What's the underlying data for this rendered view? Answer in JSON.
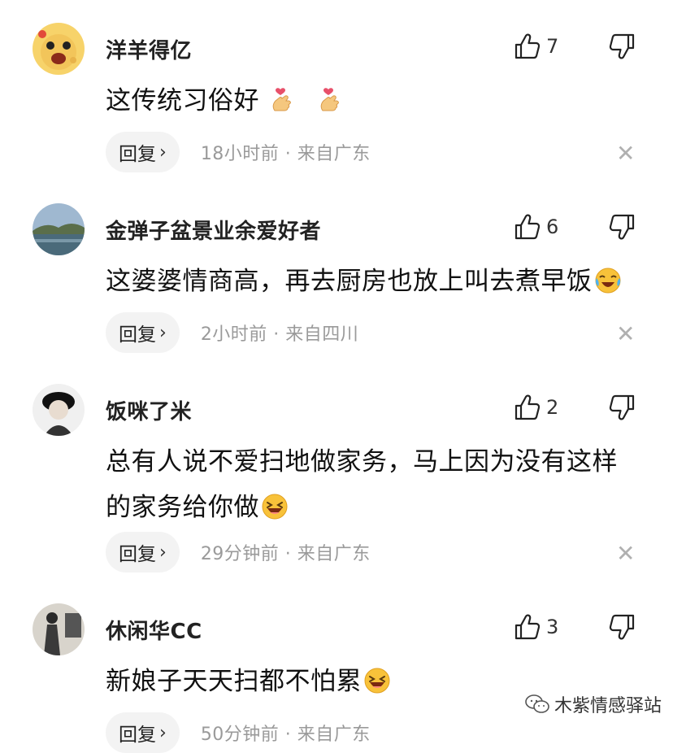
{
  "comments": [
    {
      "username": "洋羊得亿",
      "text": "这传统习俗好",
      "emojis": [
        "finger-heart-emoji",
        "finger-heart-emoji"
      ],
      "likes": "7",
      "reply_label": "回复",
      "time": "18小时前 · 来自广东"
    },
    {
      "username": "金弹子盆景业余爱好者",
      "text": "这婆婆情商高，再去厨房也放上叫去煮早饭",
      "emojis": [
        "crying-laughing-emoji"
      ],
      "likes": "6",
      "reply_label": "回复",
      "time": "2小时前 · 来自四川"
    },
    {
      "username": "饭咪了米",
      "text_line1": "总有人说不爱扫地做家务，马上因为没有这样",
      "text_line2": "的家务给你做",
      "emojis": [
        "laughing-emoji"
      ],
      "likes": "2",
      "reply_label": "回复",
      "time": "29分钟前 · 来自广东"
    },
    {
      "username": "休闲华CC",
      "text": "新娘子天天扫都不怕累",
      "emojis": [
        "laughing-emoji"
      ],
      "likes": "3",
      "reply_label": "回复",
      "time": "50分钟前 · 来自广东"
    }
  ],
  "icons": {
    "like": "thumbs-up-icon",
    "dislike": "thumbs-down-icon",
    "close": "close-icon",
    "reply_chevron": "chevron-right-icon"
  },
  "close_glyph": "✕",
  "chevron_glyph": "›",
  "watermark": "木紫情感驿站",
  "colors": {
    "text": "#111111",
    "meta": "#9a9a9a",
    "reply_bg": "#f3f3f3",
    "close": "#b0b0b0"
  }
}
